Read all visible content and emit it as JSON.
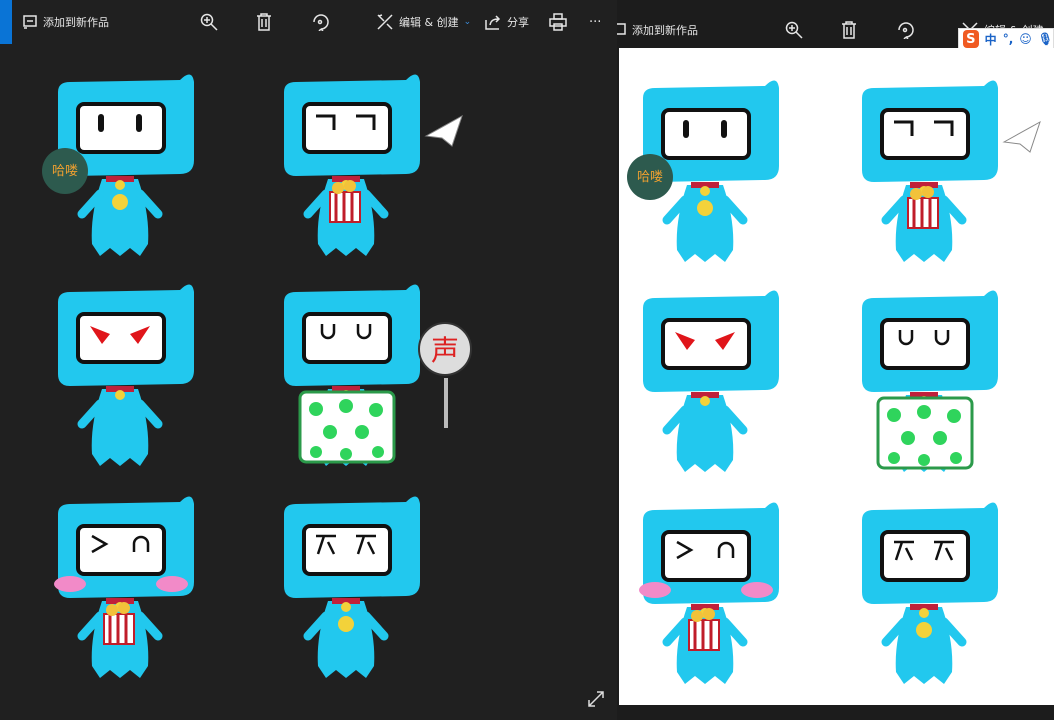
{
  "toolbar": {
    "add_to_creation": "添加到新作品",
    "edit_create": "编辑 & 创建",
    "share": "分享",
    "more": "···"
  },
  "ime": {
    "logo": "S",
    "mode": "中",
    "punct": "°,"
  },
  "stickers": {
    "hello_sign": "哈喽",
    "sound_sign": "声"
  },
  "colors": {
    "accent": "#0a74d6",
    "character": "#22c8ee",
    "dark_bg": "#202020"
  }
}
